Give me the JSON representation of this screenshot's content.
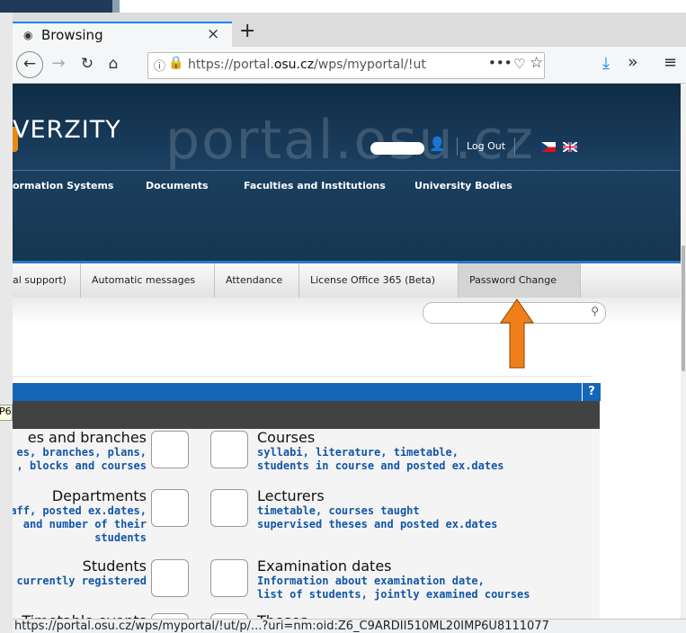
{
  "browser": {
    "tab_title": "Browsing",
    "tab_close": "×",
    "new_tab": "+",
    "url_prefix": "https://portal.",
    "url_domain": "osu.cz",
    "url_path": "/wps/myportal/!ut",
    "page_actions": "•••",
    "status_url": "https://portal.osu.cz/wps/myportal/!ut/p/...?uri=nm:oid:Z6_C9ARDII510ML20IMP6U8111077"
  },
  "header": {
    "title": "VERZITY",
    "watermark": "portal.osu.cz",
    "logout": "Log Out"
  },
  "top_nav": [
    "ormation Systems",
    "Documents",
    "Faculties and Institutions",
    "University Bodies"
  ],
  "sub_nav": [
    "al support)",
    "Automatic messages",
    "Attendance",
    "License Office 365 (Beta)",
    "Password Change"
  ],
  "help_label": "?",
  "left_items": [
    {
      "title": "es and branches",
      "sub": [
        "es, branches, plans,",
        ", blocks and courses"
      ]
    },
    {
      "title": "Departments",
      "sub": [
        "aff, posted ex.dates,",
        "and number of their",
        "students"
      ]
    },
    {
      "title": "Students",
      "sub": [
        "currently registered"
      ]
    },
    {
      "title": "Timetable events",
      "sub": []
    }
  ],
  "right_items": [
    {
      "title": "Courses",
      "sub": [
        "syllabi, literature, timetable,",
        "students in course and posted ex.dates"
      ]
    },
    {
      "title": "Lecturers",
      "sub": [
        "timetable, courses taught",
        "supervised theses and posted ex.dates"
      ]
    },
    {
      "title": "Examination dates",
      "sub": [
        "Information about examination date,",
        "list of students, jointly examined courses"
      ]
    },
    {
      "title": "Theses",
      "sub": []
    }
  ],
  "tooltip_fragment": "P6",
  "colors": {
    "accent": "#1565b8",
    "arrow": "#f07f1b",
    "header": "#163752"
  }
}
